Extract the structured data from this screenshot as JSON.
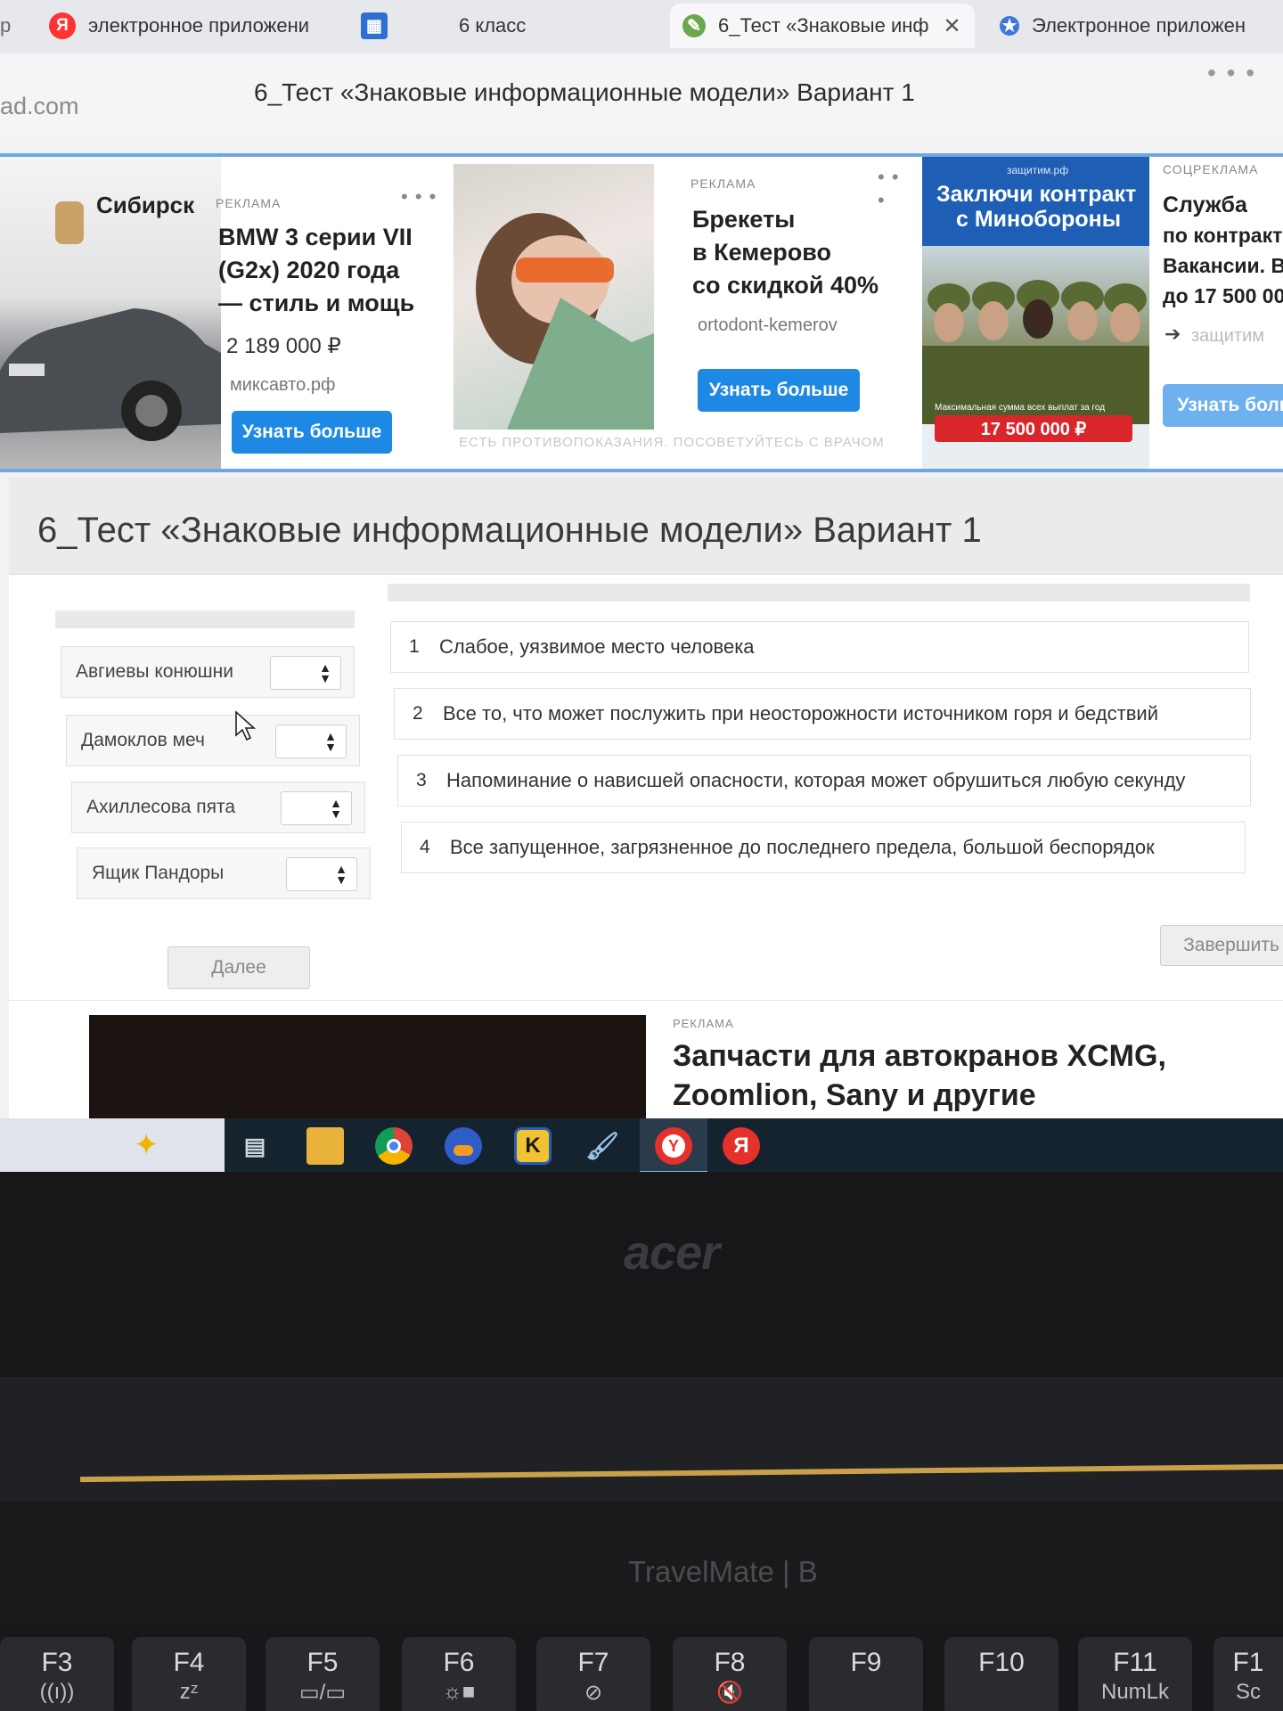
{
  "browser": {
    "tabs": [
      {
        "label": "р",
        "icon": ""
      },
      {
        "label": "электронное приложени",
        "icon": "Я"
      },
      {
        "label": "6 класс",
        "icon": ""
      },
      {
        "label": "6_Тест «Знаковые инф",
        "icon": "",
        "close": "✕"
      },
      {
        "label": "Электронное приложен",
        "icon": ""
      }
    ],
    "url_fragment": "ad.com",
    "page_title": "6_Тест «Знаковые информационные модели» Вариант 1",
    "menu_dots": "• • •"
  },
  "ads": [
    {
      "brand_text": "Сибирск",
      "label": "РЕКЛАМА",
      "more": "• • •",
      "title": [
        "BMW 3 серии VII",
        "(G2x) 2020 года",
        "— стиль и мощь"
      ],
      "price": "2 189 000 ₽",
      "source": "миксавто.рф",
      "button": "Узнать больше"
    },
    {
      "label": "РЕКЛАМА",
      "more": "• • •",
      "title": [
        "Брекеты",
        "в Кемерово",
        "со скидкой 40%"
      ],
      "source": "ortodont-kemerov",
      "button": "Узнать больше",
      "warning": "ЕСТЬ ПРОТИВОПОКАЗАНИЯ. ПОСОВЕТУЙТЕСЬ С ВРАЧОМ"
    },
    {
      "banner_site": "защитим.рф",
      "banner_title": [
        "Заключи контракт",
        "с Минобороны"
      ],
      "banner_note": "Максимальная сумма всех выплат за год",
      "banner_amount": "17 500 000 ₽"
    },
    {
      "label": "СОЦРЕКЛАМА",
      "title": [
        "Служба",
        "по контракт",
        "Вакансии. В",
        "до 17 500 00"
      ],
      "source": "защитим",
      "button": "Узнать боль"
    }
  ],
  "quiz": {
    "title": "6_Тест «Знаковые информационные модели» Вариант 1",
    "terms": [
      "Авгиевы конюшни",
      "Дамоклов меч",
      "Ахиллесова пята",
      "Ящик  Пандоры"
    ],
    "definitions": [
      {
        "num": "1",
        "text": "Слабое, уязвимое место человека"
      },
      {
        "num": "2",
        "text": "Все то, что может послужить при неосторожности источником горя и бедствий"
      },
      {
        "num": "3",
        "text": "Напоминание о нависшей опасности, которая может обрушиться любую секунду"
      },
      {
        "num": "4",
        "text": "Все запущенное, загрязненное до последнего предела, большой беспорядок"
      }
    ],
    "next_button": "Далее",
    "finish_button": "Завершить"
  },
  "bottom_ad": {
    "label": "РЕКЛАМА",
    "title": [
      "Запчасти для автокранов XCMG,",
      "Zoomlion, Sany и другие"
    ]
  },
  "taskbar": {
    "icons": [
      "sparkle-icon",
      "task-view-icon",
      "file-explorer-icon",
      "chrome-icon",
      "headphones-icon",
      "k-app-icon",
      "paint-icon",
      "yandex-browser-icon",
      "yandex-icon"
    ],
    "k_letter": "K",
    "ya_letter": "Я"
  },
  "laptop": {
    "brand": "acer",
    "model": "TravelMate | B",
    "keys": [
      {
        "label": "F3",
        "sub": "((ı))"
      },
      {
        "label": "F4",
        "sub": "zᶻ"
      },
      {
        "label": "F5",
        "sub": "▭/▭"
      },
      {
        "label": "F6",
        "sub": "☼■"
      },
      {
        "label": "F7",
        "sub": "⊘"
      },
      {
        "label": "F8",
        "sub": "🔇"
      },
      {
        "label": "F9",
        "sub": ""
      },
      {
        "label": "F10",
        "sub": ""
      },
      {
        "label": "F11",
        "sub": "NumLk"
      },
      {
        "label": "F1",
        "sub": "Sc"
      }
    ]
  }
}
